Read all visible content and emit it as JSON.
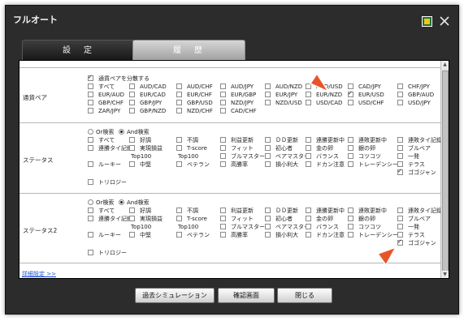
{
  "window": {
    "title": "フルオート",
    "tabs": {
      "settings": "設　定",
      "history": "履　歴"
    }
  },
  "currency": {
    "label": "通貨ペア",
    "split_option": "通貨ペアを分散する",
    "pairs": [
      [
        "すべて",
        "AUD/CAD",
        "AUD/CHF",
        "AUD/JPY",
        "AUD/NZD",
        "AUD/USD",
        "CAD/JPY",
        "CHF/JPY"
      ],
      [
        "EUR/AUD",
        "EUR/CAD",
        "EUR/CHF",
        "EUR/GBP",
        "EUR/JPY",
        "EUR/NZD",
        "EUR/USD",
        "GBP/AUD"
      ],
      [
        "GBP/CHF",
        "GBP/JPY",
        "GBP/USD",
        "NZD/JPY",
        "NZD/USD",
        "USD/CAD",
        "USD/CHF",
        "USD/JPY"
      ],
      [
        "ZAR/JPY",
        "GBP/NZD",
        "NZD/CHF",
        "CAD/CHF"
      ]
    ],
    "checked": [
      "EUR/USD"
    ]
  },
  "status": {
    "label": "ステータス",
    "radio_or": "Or検索",
    "radio_and": "And検索",
    "rows": [
      [
        "すべて",
        "好調",
        "不調",
        "利益更新",
        "ＤＤ更新",
        "連勝更新中",
        "連敗更新中",
        "連敗タイ記録"
      ],
      [
        "連勝タイ記録",
        "実現損益",
        "T-score",
        "フィット",
        "初心者",
        "金の卵",
        "銀の卵",
        "ブルベア"
      ],
      [
        "",
        "Top100",
        "Top100",
        "ブルマスター",
        "ベアマスター",
        "バランス",
        "コツコツ",
        "一発"
      ],
      [
        "ルーキー",
        "中堅",
        "ベテラン",
        "高勝率",
        "損小利大",
        "ドカン注意",
        "トレーデンシー",
        "テラス"
      ]
    ],
    "extra_last": "ゴゴジャン",
    "last": "トリロジー"
  },
  "status2": {
    "label": "ステータス2",
    "radio_or": "Or検索",
    "radio_and": "And検索",
    "rows": [
      [
        "すべて",
        "好調",
        "不調",
        "利益更新",
        "ＤＤ更新",
        "連勝更新中",
        "連敗更新中",
        "連敗タイ記録"
      ],
      [
        "連勝タイ記録",
        "実現損益",
        "T-score",
        "フィット",
        "初心者",
        "金の卵",
        "銀の卵",
        "ブルベア"
      ],
      [
        "",
        "Top100",
        "Top100",
        "ブルマスター",
        "ベアマスター",
        "バランス",
        "コツコツ",
        "一発"
      ],
      [
        "ルーキー",
        "中堅",
        "ベテラン",
        "高勝率",
        "損小利大",
        "ドカン注意",
        "トレーデンシー",
        "テラス"
      ]
    ],
    "extra_last": "ゴゴジャン",
    "last": "トリロジー"
  },
  "details_link": "詳細設定 >>",
  "buttons": {
    "simulation": "過去シミュレーション",
    "confirm": "確認画面",
    "close": "閉じる"
  },
  "colors": {
    "window": "#2c2c2c",
    "pointer": "#e8542a",
    "link": "#1a4fd0"
  },
  "icons": {
    "close": "close-icon",
    "logo": "app-logo-icon",
    "pointer": "red-pointer-arrow"
  }
}
